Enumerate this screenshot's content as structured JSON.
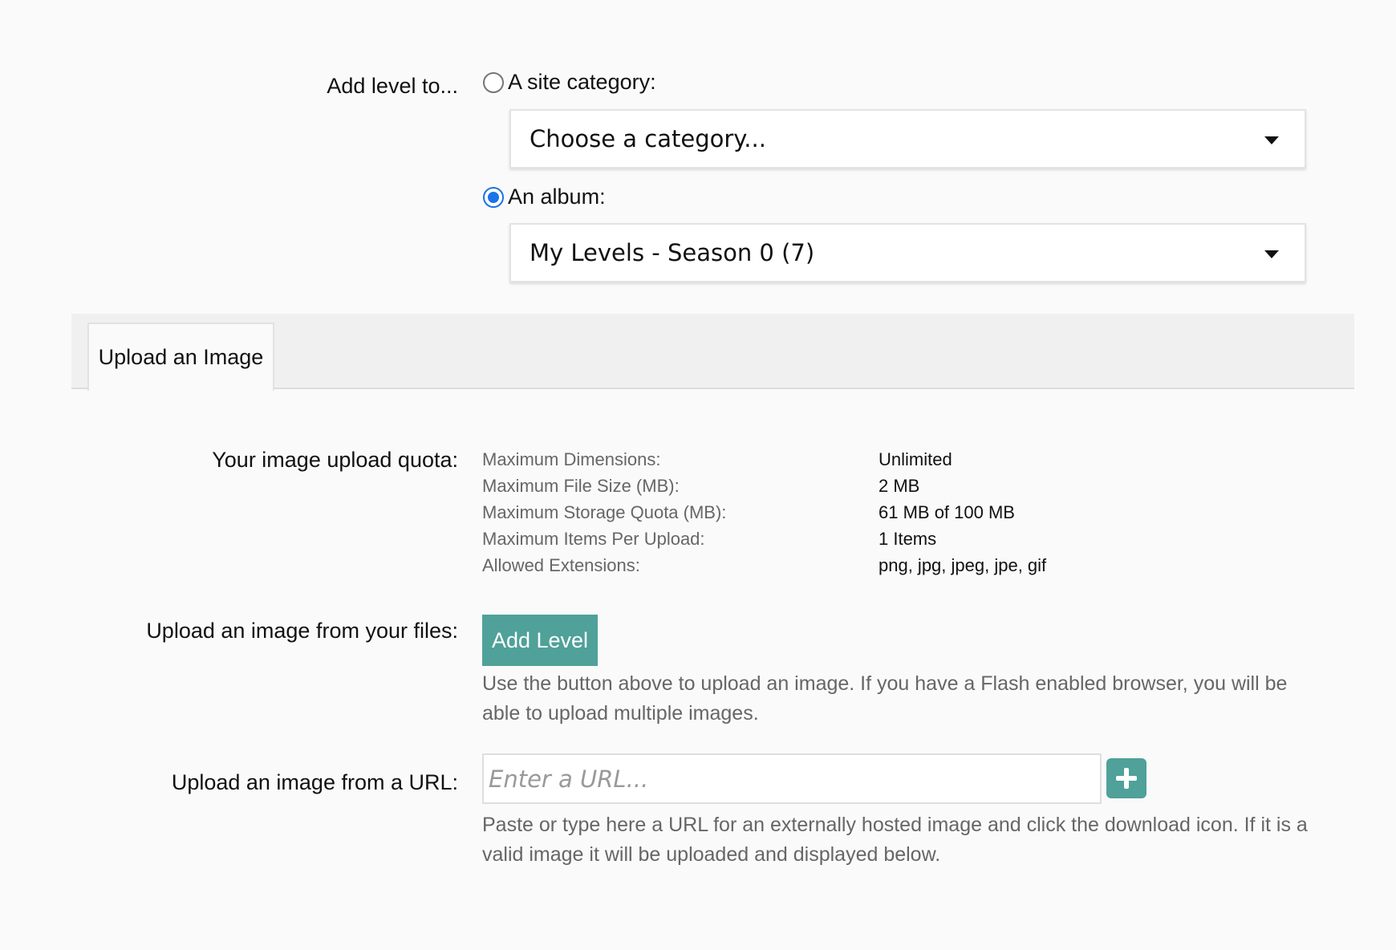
{
  "target": {
    "label": "Add level to...",
    "options": [
      {
        "label": "A site category:",
        "checked": false,
        "select_value": "Choose a category..."
      },
      {
        "label": "An album:",
        "checked": true,
        "select_value": "My Levels - Season 0 (7)"
      }
    ]
  },
  "tabs": [
    {
      "label": "Upload an Image",
      "active": true
    }
  ],
  "quota": {
    "label": "Your image upload quota:",
    "rows": [
      {
        "key": "Maximum Dimensions:",
        "value": "Unlimited"
      },
      {
        "key": "Maximum File Size (MB):",
        "value": "2 MB"
      },
      {
        "key": "Maximum Storage Quota (MB):",
        "value": "61 MB of 100 MB"
      },
      {
        "key": "Maximum Items Per Upload:",
        "value": "1 Items"
      },
      {
        "key": "Allowed Extensions:",
        "value": "png, jpg, jpeg, jpe, gif"
      }
    ]
  },
  "file_upload": {
    "label": "Upload an image from your files:",
    "button_label": "Add Level",
    "help": "Use the button above to upload an image. If you have a Flash enabled browser, you will be able to upload multiple images."
  },
  "url_upload": {
    "label": "Upload an image from a URL:",
    "placeholder": "Enter a URL...",
    "help": "Paste or type here a URL for an externally hosted image and click the download icon. If it is a valid image it will be uploaded and displayed below.",
    "icon": "plus-icon"
  },
  "colors": {
    "accent": "#4fa19a",
    "radio_checked": "#1a73e8"
  }
}
